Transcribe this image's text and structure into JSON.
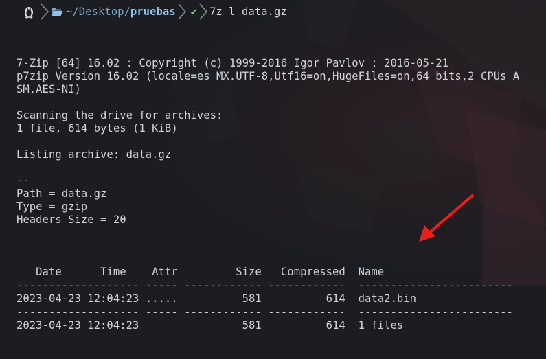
{
  "prompt": {
    "os_icon": "tux-icon",
    "path_prefix": "~/Desktop/",
    "path_dir": "pruebas",
    "status_check": "✔",
    "command": "7z l ",
    "command_arg": "data.gz"
  },
  "output": {
    "lines": [
      "7-Zip [64] 16.02 : Copyright (c) 1999-2016 Igor Pavlov : 2016-05-21",
      "p7zip Version 16.02 (locale=es_MX.UTF-8,Utf16=on,HugeFiles=on,64 bits,2 CPUs A",
      "SM,AES-NI)",
      "",
      "Scanning the drive for archives:",
      "1 file, 614 bytes (1 KiB)",
      "",
      "Listing archive: data.gz",
      "",
      "--",
      "Path = data.gz",
      "Type = gzip",
      "Headers Size = 20",
      ""
    ],
    "table": [
      "   Date      Time    Attr         Size   Compressed  Name",
      "------------------- ----- ------------ ------------  ------------------------",
      "2023-04-23 12:04:23 .....          581          614  data2.bin",
      "------------------- ----- ------------ ------------  ------------------------",
      "2023-04-23 12:04:23                581          614  1 files"
    ]
  },
  "colors": {
    "background": "#1b1d22",
    "prompt_path": "#8fc2ee",
    "prompt_ok": "#7bd36a",
    "annotation_arrow": "#e8201c"
  },
  "annotation": {
    "icon": "red-arrow-icon"
  }
}
